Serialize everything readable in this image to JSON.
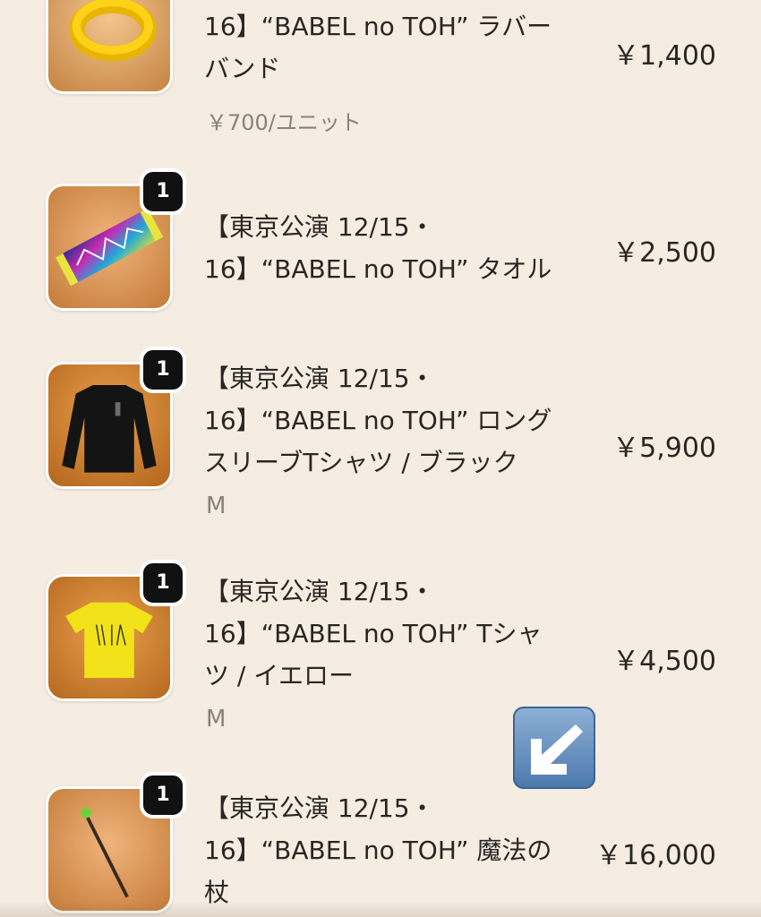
{
  "cart": {
    "items": [
      {
        "title_lines": [
          "16】“BABEL no TOH” ラバー",
          "バンド"
        ],
        "price": "￥1,400",
        "unit_price": "￥700/ユニット",
        "thumb": "rubber-band-image"
      },
      {
        "qty": "1",
        "title_lines": [
          "【東京公演 12/15・",
          "16】“BABEL no TOH” タオル"
        ],
        "price": "￥2,500",
        "thumb": "towel-image"
      },
      {
        "qty": "1",
        "title_lines": [
          "【東京公演 12/15・",
          "16】“BABEL no TOH” ロング",
          "スリーブTシャツ / ブラック"
        ],
        "variant": "M",
        "price": "￥5,900",
        "thumb": "black-long-sleeve-image"
      },
      {
        "qty": "1",
        "title_lines": [
          "【東京公演 12/15・",
          "16】“BABEL no TOH” Tシャ",
          "ツ / イエロー"
        ],
        "variant": "M",
        "price": "￥4,500",
        "thumb": "yellow-tshirt-image"
      },
      {
        "qty": "1",
        "title_lines": [
          "【東京公演 12/15・",
          "16】“BABEL no TOH” 魔法の",
          "杖"
        ],
        "price": "￥16,000",
        "thumb": "magic-wand-image"
      }
    ]
  },
  "overlay": {
    "icon": "down-left-arrow-emoji"
  },
  "colors": {
    "background": "#f5ede2",
    "badge": "#111111",
    "muted_text": "#8a827a"
  }
}
